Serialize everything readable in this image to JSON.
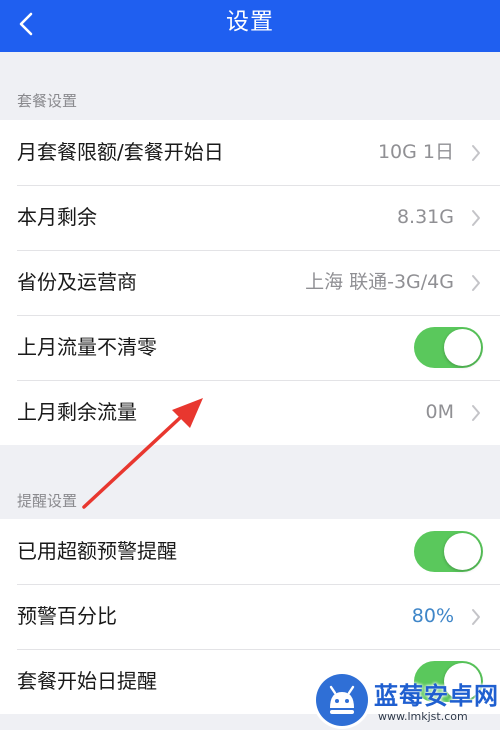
{
  "header": {
    "title": "设置",
    "back_icon": "chevron-left-icon"
  },
  "sections": [
    {
      "title": "套餐设置",
      "rows": [
        {
          "label": "月套餐限额/套餐开始日",
          "value": "10G 1日"
        },
        {
          "label": "本月剩余",
          "value": "8.31G"
        },
        {
          "label": "省份及运营商",
          "value": "上海 联通-3G/4G"
        },
        {
          "label": "上月流量不清零",
          "toggle": true
        },
        {
          "label": "上月剩余流量",
          "value": "0M"
        }
      ]
    },
    {
      "title": "提醒设置",
      "rows": [
        {
          "label": "已用超额预警提醒",
          "toggle": true
        },
        {
          "label": "预警百分比",
          "value": "80%"
        },
        {
          "label": "套餐开始日提醒",
          "toggle": true
        }
      ]
    }
  ],
  "watermark": {
    "title": "蓝莓安卓网",
    "url": "www.lmkjst.com"
  },
  "colors": {
    "nav": "#1f5ff0",
    "toggle_on": "#5ac85c",
    "accent_value": "#3f86c8",
    "annotation_arrow": "#e8372f"
  }
}
